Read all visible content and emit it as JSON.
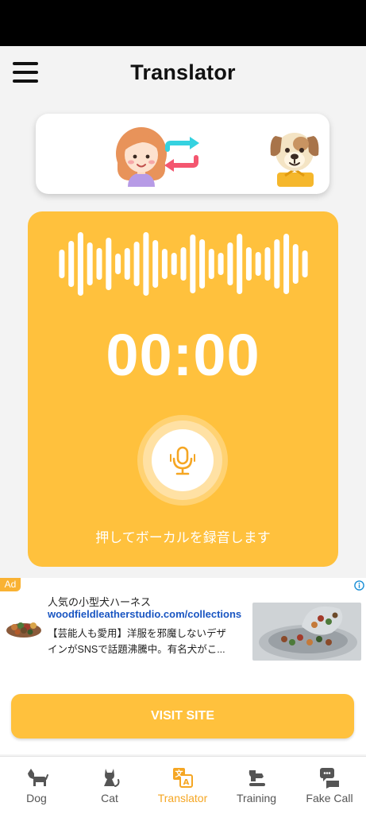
{
  "header": {
    "title": "Translator",
    "menu_icon": "hamburger-menu-icon"
  },
  "language_switch": {
    "from_icon": "girl-avatar-icon",
    "swap_icon": "swap-arrows-icon",
    "to_icon": "dog-avatar-icon"
  },
  "recorder": {
    "timer": "00:00",
    "hint": "押してボーカルを録音します",
    "mic_icon": "microphone-icon",
    "waveform_icon": "sound-wave-icon",
    "panel_color": "#ffc13d"
  },
  "ad": {
    "badge": "Ad",
    "headline": "人気の小型犬ハーネス",
    "url": "woodfieldleatherstudio.com/collections",
    "description_line1": "【芸能人も愛用】洋服を邪魔しないデザ",
    "description_line2": "インがSNSで話題沸騰中。有名犬がこ...",
    "cta": "VISIT SITE"
  },
  "nav": {
    "items": [
      {
        "label": "Dog",
        "icon": "dog-icon",
        "active": false
      },
      {
        "label": "Cat",
        "icon": "cat-icon",
        "active": false
      },
      {
        "label": "Translator",
        "icon": "translator-icon",
        "active": true
      },
      {
        "label": "Training",
        "icon": "training-icon",
        "active": false
      },
      {
        "label": "Fake Call",
        "icon": "fake-call-icon",
        "active": false
      }
    ],
    "active_color": "#f5a623"
  }
}
